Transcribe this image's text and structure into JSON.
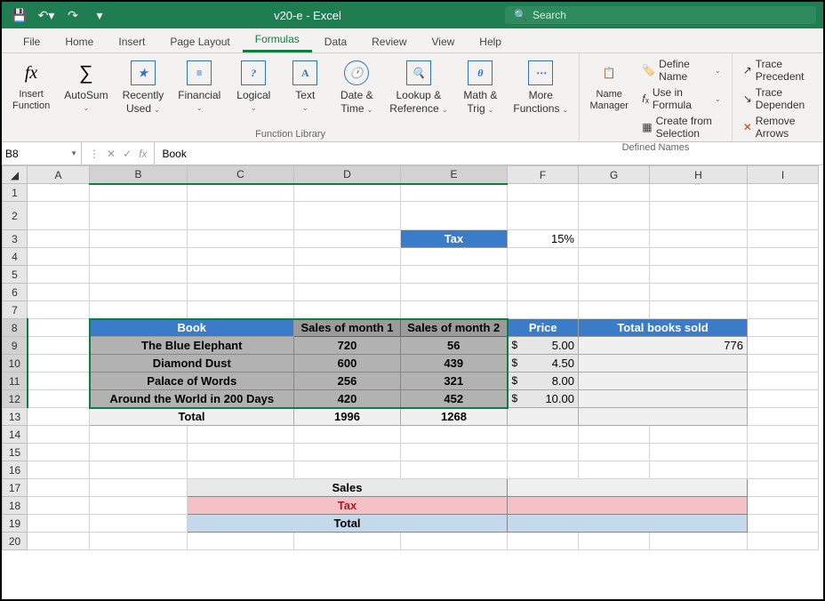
{
  "title": "v20-e  -  Excel",
  "search_placeholder": "Search",
  "tabs": [
    "File",
    "Home",
    "Insert",
    "Page Layout",
    "Formulas",
    "Data",
    "Review",
    "View",
    "Help"
  ],
  "active_tab": "Formulas",
  "ribbon": {
    "insert_function": "Insert\nFunction",
    "autosum": "AutoSum",
    "recently_used": "Recently\nUsed",
    "financial": "Financial",
    "logical": "Logical",
    "text": "Text",
    "datetime": "Date &\nTime",
    "lookup": "Lookup &\nReference",
    "mathtrig": "Math &\nTrig",
    "morefn": "More\nFunctions",
    "group_library": "Function Library",
    "name_manager": "Name\nManager",
    "define_name": "Define Name",
    "use_in_formula": "Use in Formula",
    "create_selection": "Create from Selection",
    "group_names": "Defined Names",
    "trace_precedents": "Trace Precedent",
    "trace_dependents": "Trace Dependen",
    "remove_arrows": "Remove Arrows"
  },
  "namebox": "B8",
  "formula_value": "Book",
  "cols": [
    "A",
    "B",
    "C",
    "D",
    "E",
    "F",
    "G",
    "H",
    "I"
  ],
  "cells": {
    "E3": "Tax",
    "F3": "15%",
    "B8": "Book",
    "D8": "Sales of month 1",
    "E8": "Sales of month 2",
    "F8": "Price",
    "GH8": "Total books sold",
    "B9": "The Blue Elephant",
    "D9": "720",
    "E9": "56",
    "F9": "$        5.00",
    "GH9": "776",
    "B10": "Diamond Dust",
    "D10": "600",
    "E10": "439",
    "F10": "$        4.50",
    "B11": "Palace of Words",
    "D11": "256",
    "E11": "321",
    "F11": "$        8.00",
    "B12": "Around the World in 200 Days",
    "D12": "420",
    "E12": "452",
    "F12": "$      10.00",
    "B13": "Total",
    "D13": "1996",
    "E13": "1268",
    "S17": "Sales",
    "S18": "Tax",
    "S19": "Total"
  }
}
